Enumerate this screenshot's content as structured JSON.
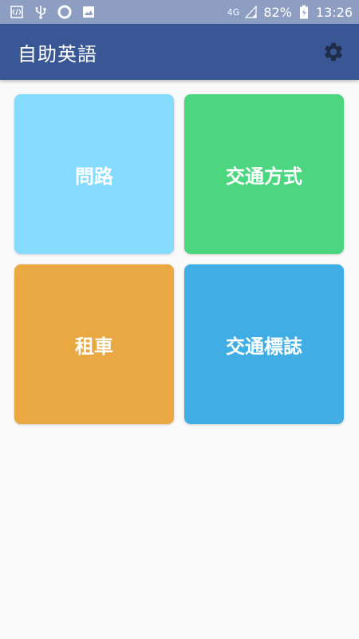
{
  "status_bar": {
    "network": "4G",
    "battery": "82%",
    "time": "13:26",
    "icons": [
      "code-icon",
      "usb-icon",
      "circle-icon",
      "image-icon",
      "signal-icon",
      "battery-charging-icon"
    ]
  },
  "app_bar": {
    "title": "自助英語",
    "settings_icon": "gear-icon"
  },
  "tiles": [
    {
      "label": "問路",
      "color": "#85dcff"
    },
    {
      "label": "交通方式",
      "color": "#4cd680"
    },
    {
      "label": "租車",
      "color": "#e9a841"
    },
    {
      "label": "交通標誌",
      "color": "#41ade5"
    }
  ]
}
